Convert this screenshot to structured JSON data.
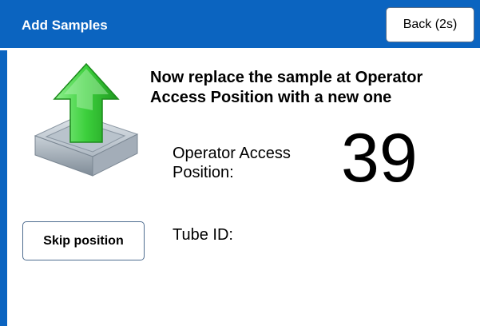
{
  "header": {
    "title": "Add Samples",
    "back_label": "Back (2s)"
  },
  "icon": "upload-tray-icon",
  "content": {
    "instruction": "Now replace the sample at Operator Access Position with a new one",
    "position_label": "Operator Access Position:",
    "position_number": "39",
    "tube_id_label": "Tube ID:",
    "tube_id_value": ""
  },
  "actions": {
    "skip_label": "Skip position"
  },
  "colors": {
    "header_blue": "#0b64c0",
    "arrow_green": "#3cc43c",
    "tray_gray": "#9aa5b0"
  }
}
